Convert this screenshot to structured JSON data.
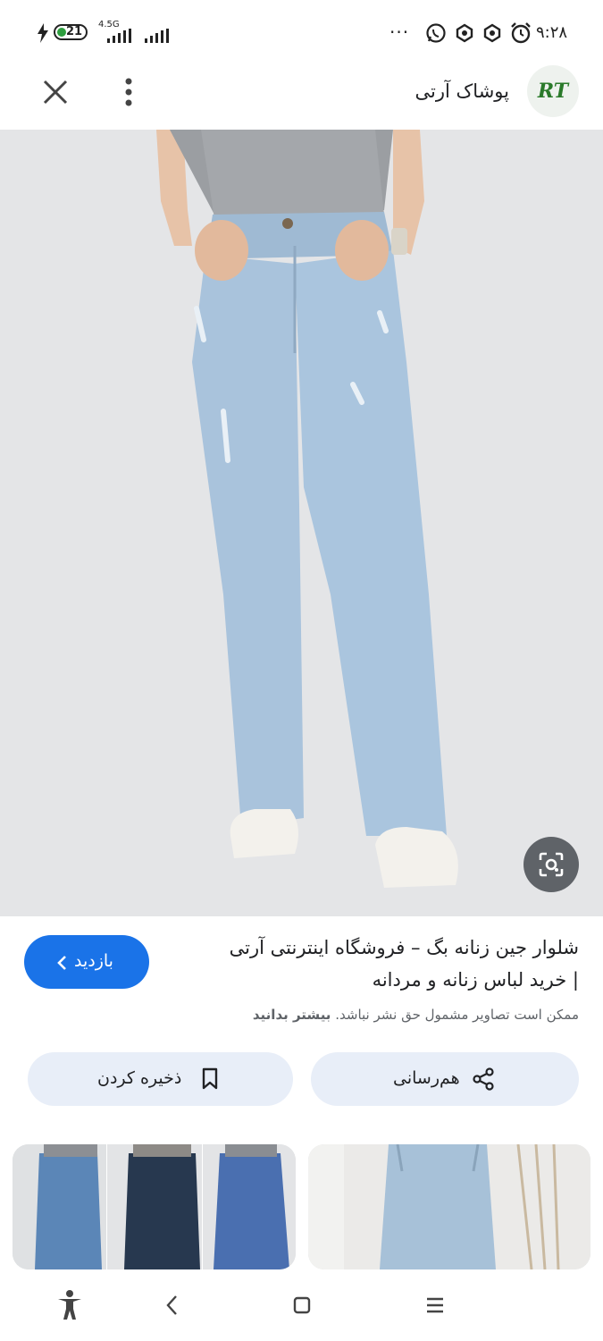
{
  "status_bar": {
    "time": "۹:۲۸",
    "battery": "21",
    "network": "4.5G",
    "more": "···"
  },
  "header": {
    "site_name": "پوشاک آرتی",
    "logo_text": "RT"
  },
  "result": {
    "title_line1": "شلوار جین زنانه بگ – فروشگاه اینترنتی آرتی",
    "title_line2": "| خرید لباس زنانه و مردانه",
    "notice_text": "ممکن است تصاویر مشمول حق نشر نباشد.",
    "notice_link": "بیشتر بدانید",
    "visit_label": "بازدید"
  },
  "actions": {
    "share_label": "هم‌رسانی",
    "save_label": "ذخیره کردن"
  },
  "colors": {
    "accent": "#1a73e8",
    "pill_bg": "#e8eef8",
    "denim": "#a9c3dc"
  },
  "icons": [
    "close-icon",
    "more-vert-icon",
    "lens-icon",
    "share-icon",
    "bookmark-icon",
    "chevron-left-icon",
    "accessibility-icon",
    "back-icon",
    "home-icon",
    "recents-icon"
  ]
}
